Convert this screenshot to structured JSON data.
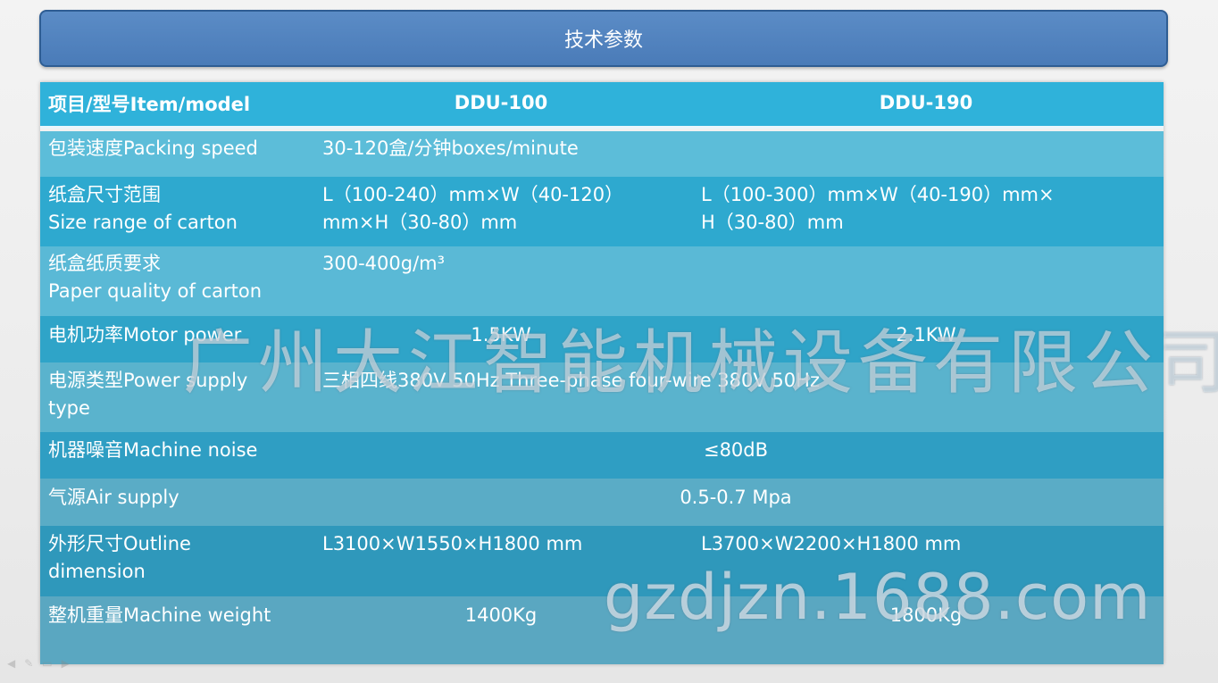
{
  "title": "技术参数",
  "colors": {
    "banner": "#4f80bd",
    "header": "#2fb0d8",
    "row_light": "#5bbcd8",
    "row_dark": "#2fa7cc"
  },
  "header": {
    "col1": "项目/型号Item/model",
    "col2": "DDU-100",
    "col3": "DDU-190"
  },
  "rows": [
    {
      "label": [
        "包装速度Packing speed"
      ],
      "value": [
        "30-120盒/分钟boxes/minute"
      ]
    },
    {
      "label": [
        "纸盒尺寸范围",
        "Size range of carton"
      ],
      "v1": [
        "L（100-240）mm×W（40-120）",
        "mm×H（30-80）mm"
      ],
      "v2": [
        "L（100-300）mm×W（40-190）mm×",
        "H（30-80）mm"
      ]
    },
    {
      "label": [
        "纸盒纸质要求",
        "Paper quality of carton"
      ],
      "value": [
        "300-400g/m³"
      ]
    },
    {
      "label": [
        "电机功率Motor power"
      ],
      "v1": [
        "1.5KW"
      ],
      "v2": [
        "2.1KW"
      ]
    },
    {
      "label": [
        "电源类型Power supply",
        "type"
      ],
      "value": [
        "三相四线380V 50Hz Three-phase four-wire 380V 50Hz"
      ]
    },
    {
      "label": [
        "机器噪音Machine noise"
      ],
      "value": [
        "≤80dB"
      ]
    },
    {
      "label": [
        "气源Air supply"
      ],
      "value": [
        "0.5-0.7 Mpa"
      ]
    },
    {
      "label": [
        "外形尺寸Outline",
        "dimension"
      ],
      "v1": [
        "L3100×W1550×H1800 mm"
      ],
      "v2": [
        "L3700×W2200×H1800 mm"
      ]
    },
    {
      "label": [
        "整机重量Machine weight"
      ],
      "v1": [
        "1400Kg"
      ],
      "v2": [
        "1800Kg"
      ]
    }
  ],
  "watermark": {
    "company": "广州大江智能机械设备有限公司",
    "site": "gzdjzn.1688.com"
  }
}
